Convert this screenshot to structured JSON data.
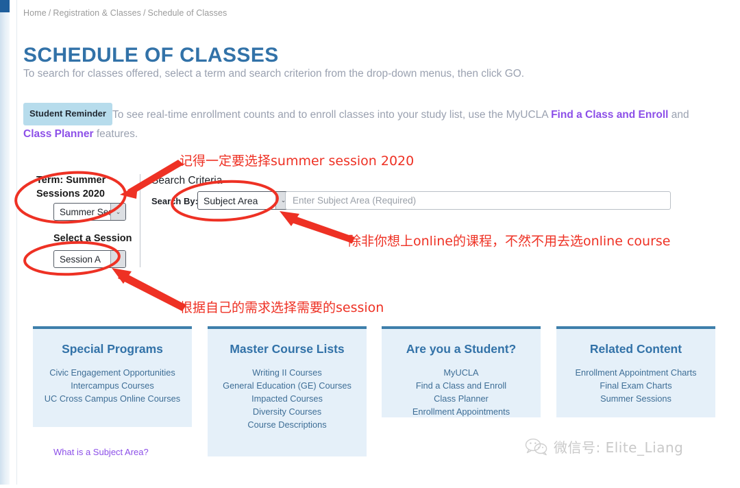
{
  "breadcrumb": {
    "items": [
      "Home",
      "Registration & Classes",
      "Schedule of Classes"
    ],
    "separator": "/"
  },
  "header": {
    "title": "SCHEDULE OF CLASSES",
    "intro": "To search for classes offered, select a term and search criterion from the drop-down menus, then click GO."
  },
  "reminder": {
    "badge": "Student Reminder",
    "text_before": "To see real-time enrollment counts and to enroll classes into your study list, use the MyUCLA ",
    "link_1": "Find a Class and Enroll",
    "text_middle": " and ",
    "link_2": "Class Planner",
    "text_after": " features."
  },
  "form": {
    "term_label": "Term: Summer Sessions 2020",
    "term_value": "Summer Sess",
    "session_label": "Select a Session",
    "session_value": "Session A",
    "subject_help_link": "What is a Subject Area?",
    "search_criteria_label": "Search Criteria",
    "search_by_label": "Search By:",
    "search_by_value": "Subject Area",
    "subject_input_placeholder": "Enter Subject Area (Required)",
    "caret_glyph": "⌄"
  },
  "annotations": [
    {
      "id": "anno-1",
      "text": "记得一定要选择summer session 2020"
    },
    {
      "id": "anno-2",
      "text": "除非你想上online的课程，不然不用去选online course"
    },
    {
      "id": "anno-3",
      "text": "根据自己的需求选择需要的session"
    }
  ],
  "annotation_color": "#ee3124",
  "cards": [
    {
      "title": "Special Programs",
      "links": [
        "Civic Engagement Opportunities",
        "Intercampus Courses",
        "UC Cross Campus Online Courses"
      ]
    },
    {
      "title": "Master Course Lists",
      "links": [
        "Writing II Courses",
        "General Education (GE) Courses",
        "Impacted Courses",
        "Diversity Courses",
        "Course Descriptions"
      ]
    },
    {
      "title": "Are you a Student?",
      "links": [
        "MyUCLA",
        "Find a Class and Enroll",
        "Class Planner",
        "Enrollment Appointments"
      ]
    },
    {
      "title": "Related Content",
      "links": [
        "Enrollment Appointment Charts",
        "Final Exam Charts",
        "Summer Sessions"
      ]
    }
  ],
  "watermark": {
    "text": "微信号: Elite_Liang"
  },
  "colors": {
    "title_blue": "#3272a8",
    "card_bg": "#e5f0f9",
    "card_border": "#3e7fab",
    "link_purple": "#8c4fe8",
    "badge_bg": "#b7dcec",
    "annotation_red": "#ee3124"
  }
}
